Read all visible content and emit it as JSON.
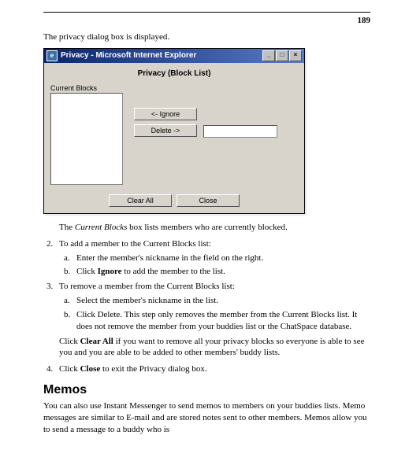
{
  "page_number": "189",
  "intro_line": "The privacy dialog box is displayed.",
  "dialog": {
    "window_title": "Privacy - Microsoft Internet Explorer",
    "heading": "Privacy (Block List)",
    "blocks_label": "Current Blocks",
    "ignore_btn": "<- Ignore",
    "delete_btn": "Delete ->",
    "clear_all_btn": "Clear All",
    "close_btn": "Close",
    "min_btn": "_",
    "max_btn": "□",
    "x_btn": "×",
    "icon_glyph": "e"
  },
  "caption_prefix": "The ",
  "caption_italic": "Current Blocks",
  "caption_suffix": " box lists members who are currently blocked.",
  "step2": {
    "marker": "2.",
    "text": "To add a member to the Current Blocks list:",
    "a_marker": "a.",
    "a_text": "Enter the member's nickname in the field on the right.",
    "b_marker": "b.",
    "b_prefix": "Click ",
    "b_bold": "Ignore",
    "b_suffix": " to add the member to the  list."
  },
  "step3": {
    "marker": "3.",
    "text": "To remove a member from the Current Blocks list:",
    "a_marker": "a.",
    "a_text": "Select the member's nickname in the list.",
    "b_marker": "b.",
    "b_text": "Click Delete.  This step only removes the member from the Current Blocks list.  It does not remove the member from your buddies list or the ChatSpace database.",
    "clearall_prefix": "Click ",
    "clearall_bold": "Clear All",
    "clearall_suffix": " if you want to remove all your privacy blocks so everyone is able to see you and you are able to be added to other members' buddy lists."
  },
  "step4": {
    "marker": "4.",
    "prefix": "Click ",
    "bold": "Close",
    "suffix": " to exit the Privacy dialog box."
  },
  "memos": {
    "heading": "Memos",
    "para": "You can also use Instant Messenger to send memos to members on your buddies lists.  Memo messages are similar to E-mail and are stored notes sent to other members. Memos allow you to send a message to a buddy who is"
  }
}
